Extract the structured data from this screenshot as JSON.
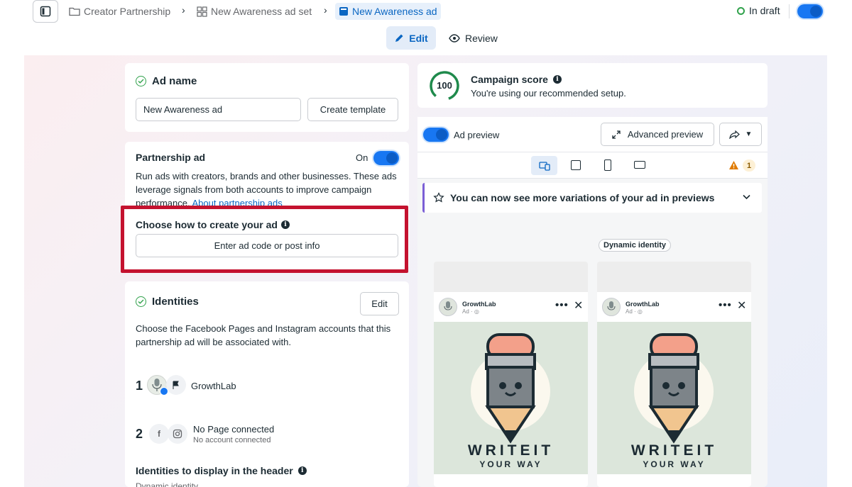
{
  "breadcrumb": {
    "campaign": "Creator Partnership",
    "ad_set": "New Awareness ad set",
    "ad": "New Awareness ad"
  },
  "status": "In draft",
  "tabs": {
    "edit": "Edit",
    "review": "Review"
  },
  "ad_name": {
    "title": "Ad name",
    "value": "New Awareness ad",
    "template_button": "Create template"
  },
  "partnership": {
    "title": "Partnership ad",
    "toggle_label": "On",
    "description": "Run ads with creators, brands and other businesses. These ads leverage signals from both accounts to improve campaign performance.",
    "link": "About partnership ads"
  },
  "create_method": {
    "title": "Choose how to create your ad",
    "button": "Enter ad code or post info"
  },
  "identities": {
    "title": "Identities",
    "edit_button": "Edit",
    "description": "Choose the Facebook Pages and Instagram accounts that this partnership ad will be associated with.",
    "items": [
      {
        "index": "1",
        "name": "GrowthLab"
      },
      {
        "index": "2",
        "page": "No Page connected",
        "account": "No account connected"
      }
    ],
    "header_title": "Identities to display in the header",
    "header_value": "Dynamic identity"
  },
  "campaign_score": {
    "score": "100",
    "title": "Campaign score",
    "subtitle": "You're using our recommended setup."
  },
  "preview": {
    "toggle_label": "Ad preview",
    "advanced_button": "Advanced preview",
    "warning_count": "1",
    "banner": "You can now see more variations of your ad in previews",
    "identity_pill": "Dynamic identity",
    "cards": [
      {
        "brand": "GrowthLab",
        "sponsored": "Ad · ◎",
        "headline": "WRITEIT",
        "tagline": "YOUR WAY"
      },
      {
        "brand": "GrowthLab",
        "sponsored": "Ad · ◎",
        "headline": "WRITEIT",
        "tagline": "YOUR WAY"
      }
    ]
  },
  "colors": {
    "accent": "#0a66c2",
    "highlight": "#c4122f",
    "success": "#31a24c",
    "warning": "#e07b00"
  }
}
